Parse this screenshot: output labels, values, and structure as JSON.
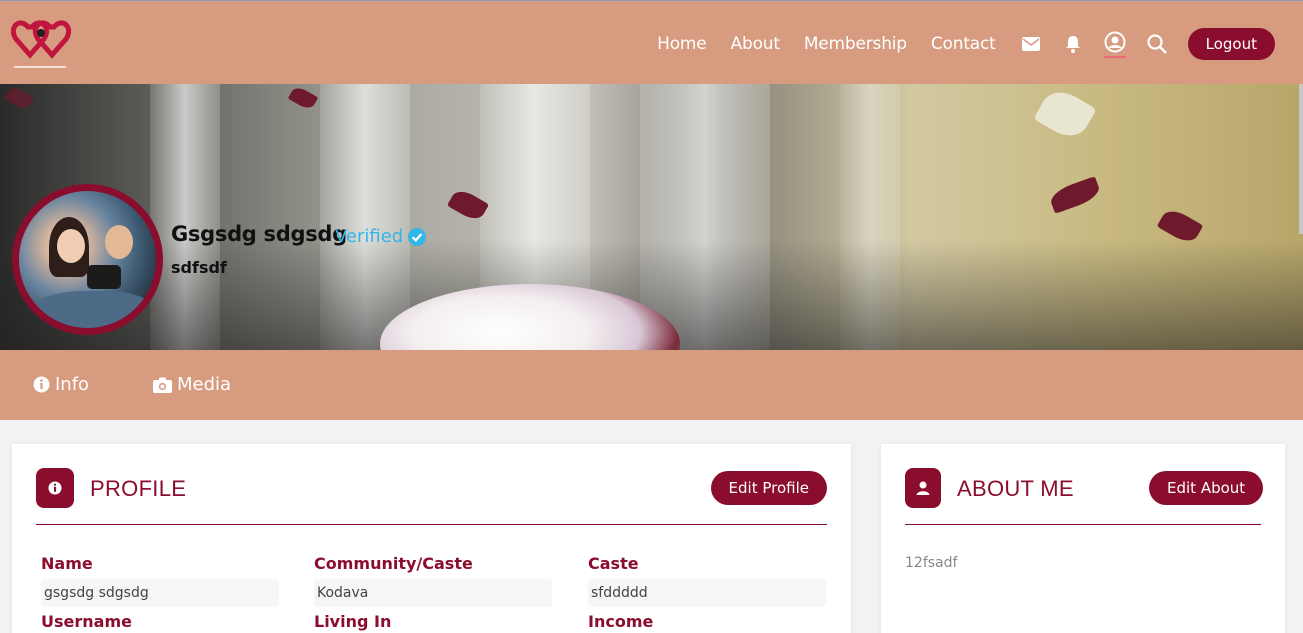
{
  "nav": {
    "links": [
      "Home",
      "About",
      "Membership",
      "Contact"
    ],
    "icons": [
      "envelope-icon",
      "bell-icon",
      "user-circle-icon",
      "search-icon"
    ],
    "logout_label": "Logout",
    "brand_color": "#8b0d2e",
    "bar_color": "#d79b80"
  },
  "profile_header": {
    "name": "Gsgsdg sdgsdg",
    "verified_label": "Verified",
    "subtitle": "sdfsdf"
  },
  "tabs": [
    "Info",
    "Media"
  ],
  "profile_card": {
    "title": "PROFILE",
    "edit_label": "Edit Profile",
    "fields": [
      {
        "label": "Name",
        "value": "gsgsdg sdgsdg"
      },
      {
        "label": "Community/Caste",
        "value": "Kodava"
      },
      {
        "label": "Caste",
        "value": "sfddddd"
      },
      {
        "label": "Username",
        "value": ""
      },
      {
        "label": "Living In",
        "value": ""
      },
      {
        "label": "Income",
        "value": ""
      }
    ]
  },
  "about_card": {
    "title": "ABOUT ME",
    "edit_label": "Edit About",
    "text": "12fsadf"
  }
}
